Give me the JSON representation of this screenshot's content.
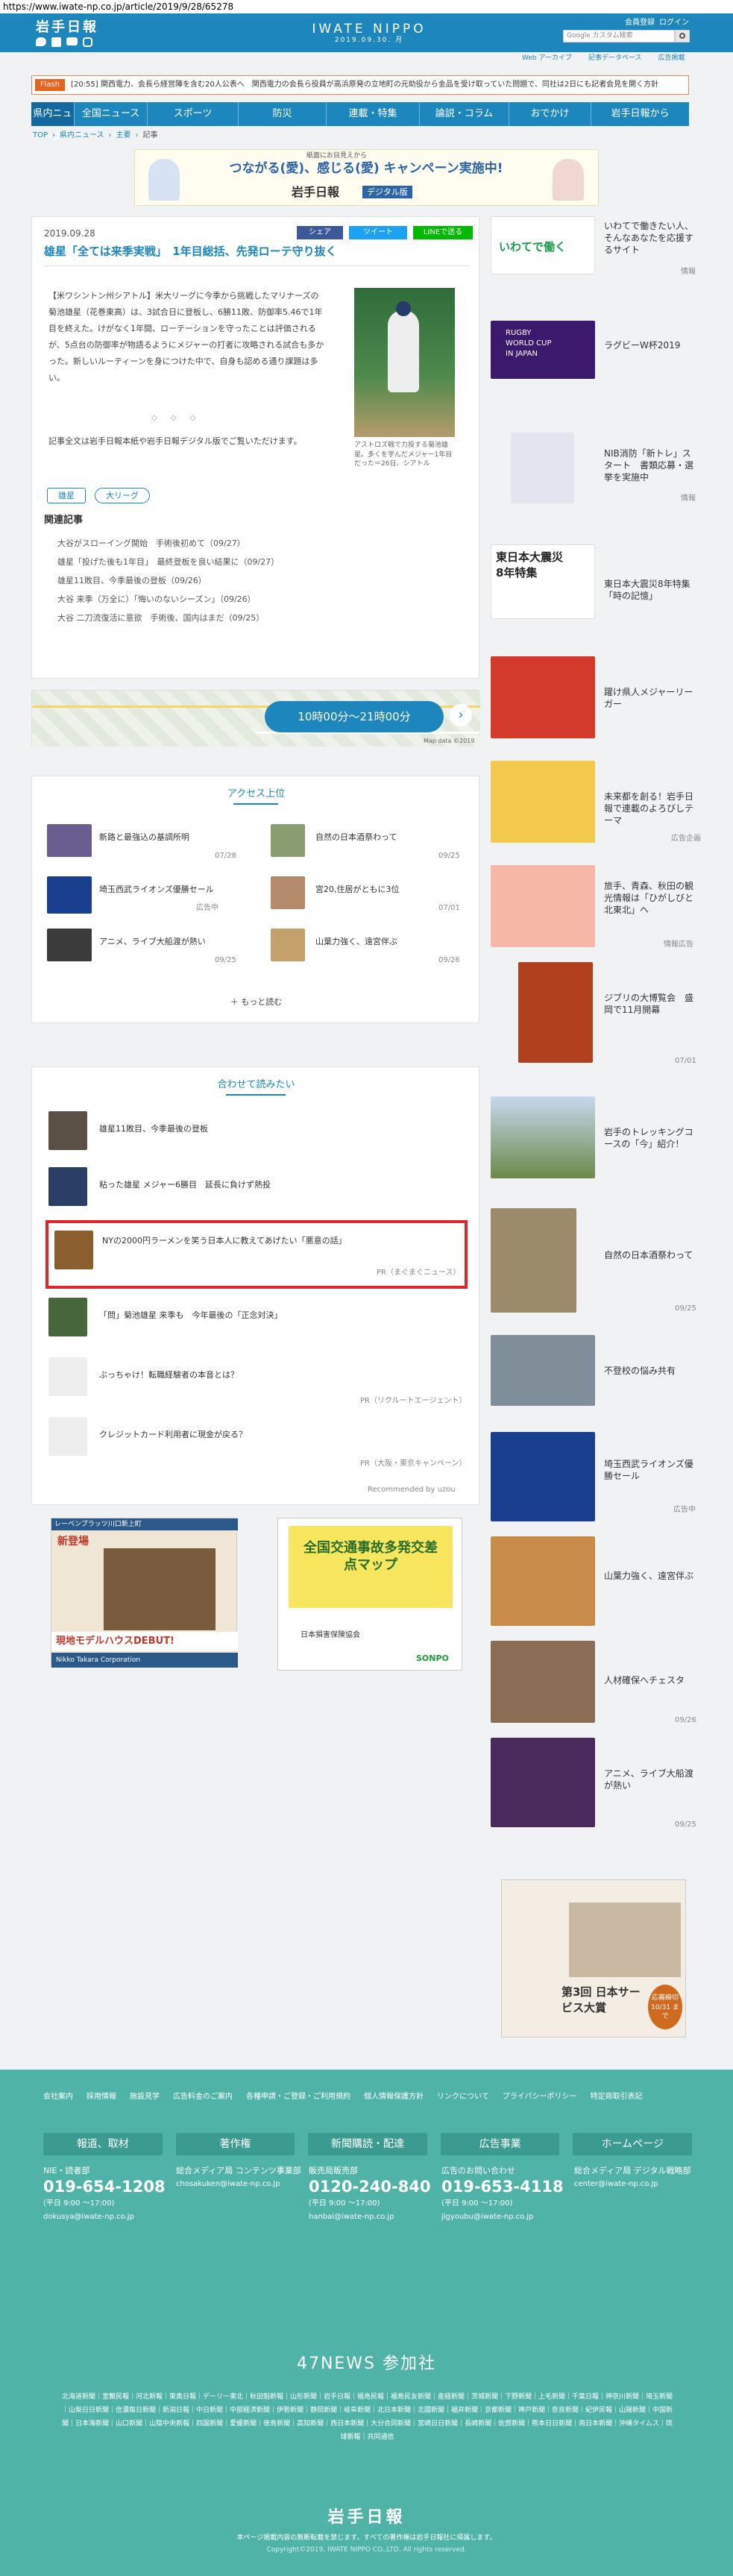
{
  "browser": {
    "url": "https://www.iwate-np.co.jp/article/2019/9/28/65278"
  },
  "header": {
    "logo_ja": "岩手日報",
    "brand": "IWATE NIPPO",
    "date": "2019.09.30. 月",
    "links": [
      "会員登録",
      "ログイン"
    ],
    "search_placeholder": "Google カスタム検索",
    "sub_links": [
      "Web アーカイブ",
      "記事データベース",
      "広告掲載"
    ],
    "social": [
      "twitter-icon",
      "facebook-icon",
      "youtube-icon",
      "instagram-icon"
    ]
  },
  "flash": {
    "label": "Flash",
    "time": "[20:55]",
    "text": "関西電力、会長ら経営陣を含む20人公表へ　関西電力の会長ら役員が高浜原発の立地町の元助役から金品を受け取っていた問題で、同社は2日にも記者会見を開く方針"
  },
  "nav": {
    "tabs": [
      "県内ニュース",
      "全国ニュース",
      "スポーツ",
      "防災",
      "連載・特集",
      "論説・コラム",
      "おでかけ",
      "岩手日報から"
    ]
  },
  "breadcrumb": [
    "TOP",
    "県内ニュース",
    "主要",
    "記事"
  ],
  "banner": {
    "subtitle": "紙面にお目見えから",
    "text": "つながる(愛)、感じる(愛) キャンペーン実施中!",
    "brand": "岩手日報",
    "tag": "デジタル版"
  },
  "article": {
    "date": "2019.09.28",
    "share_buttons": [
      "シェア",
      "ツイート",
      "LINEで送る"
    ],
    "title": "雄星「全ては来季実戦」　1年目総括、先発ローテ守り抜く",
    "body": "【米ワシントン州シアトル】米大リーグに今季から挑戦したマリナーズの菊池雄星（花巻東高）は、3試合日に登板し、6勝11敗、防御率5.46で1年目を終えた。けがなく1年間、ローテーションを守ったことは評価されるが、5点台の防御率が物語るようにメジャーの打者に攻略される試合も多かった。新しいルーティーンを身につけた中で、自身も認める通り課題は多い。",
    "body2": "記事全文は岩手日報本紙や岩手日報デジタル版でご覧いただけます。",
    "caption": "アストロズ戦で力投する菊池雄星。多くを学んだメジャー1年目だった＝26日、シアトル",
    "tags": [
      "雄星",
      "大リーグ"
    ],
    "related_title": "関連記事",
    "related": [
      "大谷がスローイング開始　手術後初めて（09/27）",
      "雄星「投げた後も1年目」　最終登板を良い結果に（09/27）",
      "雄星11敗目、今季最後の登板（09/26）",
      "大谷 来季（万全に）「悔いのないシーズン」（09/26）",
      "大谷 二刀流復活に意欲　手術後、国内はまだ（09/25）"
    ]
  },
  "map_ad": {
    "text": "10時00分～21時00分",
    "credit": "Map data ©2019"
  },
  "ranking": {
    "title": "アクセス上位",
    "items": [
      {
        "text": "新路と最強込の基調所明",
        "date": "07/28"
      },
      {
        "text": "自然の日本酒祭わって",
        "date": "09/25"
      },
      {
        "text": "埼玉西武ライオンズ優勝セール",
        "date": "広告中"
      },
      {
        "text": "宮20,住居がともに3位",
        "date": "07/01"
      },
      {
        "text": "アニメ、ライブ大船渡が熱い",
        "date": "09/25"
      },
      {
        "text": "山葉力強く、遠宮伴ぶ",
        "date": "09/26"
      }
    ],
    "more": "もっと読む"
  },
  "recommend": {
    "title": "合わせて読みたい",
    "items": [
      {
        "text": "雄星11敗目、今季最後の登板",
        "meta": ""
      },
      {
        "text": "粘った雄星 メジャー6勝目　延長に負けず熱投",
        "meta": ""
      },
      {
        "text": "NYの2000円ラーメンを笑う日本人に教えてあげたい「悪意の話」",
        "meta": "PR（まぐまぐニュース）"
      },
      {
        "text": "「問」菊池雄星 来季も　今年最後の「正念対決」",
        "meta": ""
      },
      {
        "text": "ぶっちゃけ！転職経験者の本音とは？",
        "meta": "PR（リクルートエージェント）"
      },
      {
        "text": "クレジットカード利用者に現金が戻る？",
        "meta": "PR（大阪・東京キャンペーン）"
      }
    ],
    "powered": "Recommended by uzou"
  },
  "ads_bottom": [
    {
      "title": "新登場",
      "sub": "レーベンプラッツ川口新上町",
      "bottom": "現地モデルハウスDEBUT!",
      "brand": "Nikko Takara Corporation"
    },
    {
      "title": "全国交通事故多発交差点マップ",
      "sub": "日本損害保険協会",
      "brand": "SONPO"
    }
  ],
  "sidebar": [
    {
      "text": "いわてで働きたい人、そんなあなたを応援するサイト",
      "meta": "情報"
    },
    {
      "text": "ラグビーW杯2019",
      "meta": ""
    },
    {
      "text": "NIB消防「新トレ」スタート　書類応募・選挙を実施中",
      "meta": "情報"
    },
    {
      "text": "東日本大震災8年特集「時の記憶」",
      "meta": ""
    },
    {
      "text": "躍け県人メジャーリーガー",
      "meta": ""
    },
    {
      "text": "未来都を創る！岩手日報で連載のよろびしテーマ",
      "meta": "広告企画"
    },
    {
      "text": "旅手、青森、秋田の観光情報は「ひがしびと北東北」へ",
      "meta": "情報広告"
    },
    {
      "text": "ジブリの大博覧会　盛岡で11月開幕",
      "meta": "07/01"
    },
    {
      "text": "岩手のトレッキングコースの「今」紹介！",
      "meta": ""
    },
    {
      "text": "自然の日本酒祭わって",
      "meta": "09/25"
    },
    {
      "text": "不登校の悩み共有",
      "meta": ""
    },
    {
      "text": "埼玉西武ライオンズ優勝セール",
      "meta": "広告中"
    },
    {
      "text": "山葉力強く、遠宮伴ぶ",
      "meta": ""
    },
    {
      "text": "人材確保へチェスタ",
      "meta": "09/26"
    },
    {
      "text": "アニメ、ライブ大船渡が熱い",
      "meta": "09/25"
    }
  ],
  "side_ad": {
    "title": "第3回 日本サービス大賞",
    "deadline": "応募締切 10/31 まで"
  },
  "footer": {
    "links": [
      "会社案内",
      "採用情報",
      "施設見学",
      "広告料金のご案内",
      "各種申請・ご登録・ご利用規約",
      "個人情報保護方針",
      "リンクについて",
      "プライバシーポリシー",
      "特定商取引表記"
    ],
    "boxes": [
      "報道、取材",
      "著作権",
      "新聞購読・配達",
      "広告事業",
      "ホームページ"
    ],
    "contacts": [
      {
        "head": "NIE・読者部",
        "phone": "019-654-1208",
        "hours": "(平日 9:00 ～17:00)",
        "mail": "dokusya@iwate-np.co.jp"
      },
      {
        "head": "総合メディア局 コンテンツ事業部",
        "phone": "",
        "hours": "",
        "mail": "chosakuken@iwate-np.co.jp"
      },
      {
        "head": "販売局販売部",
        "phone": "0120-240-840",
        "hours": "(平日 9:00 ～17:00)",
        "mail": "hanbai@iwate-np.co.jp"
      },
      {
        "head": "広告のお問い合わせ",
        "phone": "019-653-4118",
        "hours": "(平日 9:00 ～17:00)",
        "mail": "jigyoubu@iwate-np.co.jp"
      },
      {
        "head": "総合メディア局 デジタル戦略部",
        "phone": "",
        "hours": "",
        "mail": "center@iwate-np.co.jp"
      }
    ],
    "news47": "47NEWS 参加社",
    "papers": "北海道新聞｜室蘭民報｜河北新報｜東奥日報｜デーリー東北｜秋田魁新報｜山形新聞｜岩手日報｜福島民報｜福島民友新聞｜産経新聞｜茨城新聞｜下野新聞｜上毛新聞｜千葉日報｜神奈川新聞｜埼玉新聞｜山梨日日新聞｜信濃毎日新聞｜新潟日報｜中日新聞｜中部経済新聞｜伊勢新聞｜静岡新聞｜岐阜新聞｜北日本新聞｜北國新聞｜福井新聞｜京都新聞｜神戸新聞｜奈良新聞｜紀伊民報｜山陽新聞｜中国新聞｜日本海新聞｜山口新聞｜山陰中央新報｜四国新聞｜愛媛新聞｜徳島新聞｜高知新聞｜西日本新聞｜大分合同新聞｜宮崎日日新聞｜長崎新聞｜佐賀新聞｜熊本日日新聞｜南日本新聞｜沖縄タイムス｜琉球新報｜共同通信",
    "logo": "岩手日報",
    "copyright": "本ページ掲載内容の無断転載を禁じます。すべての著作権は岩手日報社に帰属します。",
    "copyright2": "Copyright©2019, IWATE NIPPO CO.,LTD. All rights reserved."
  }
}
